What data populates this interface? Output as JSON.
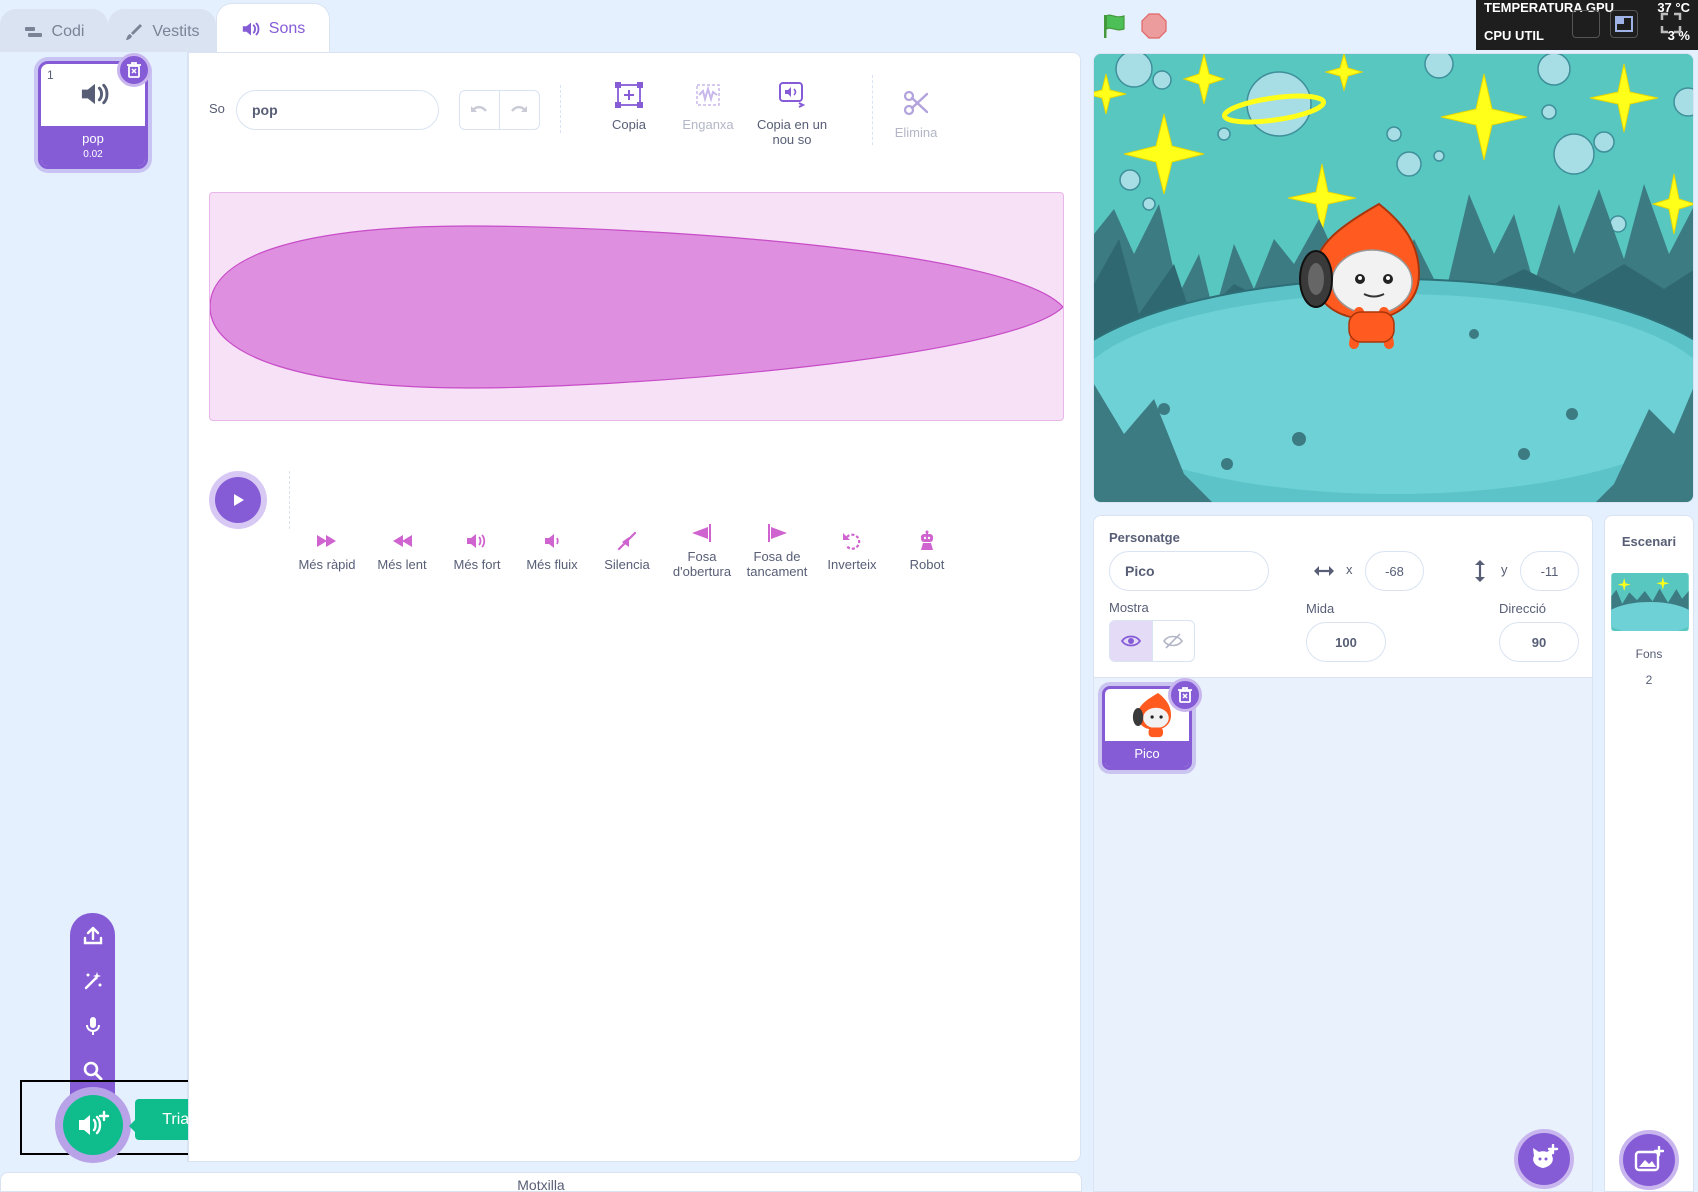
{
  "tabs": [
    {
      "label": "Codi",
      "icon": "code-icon"
    },
    {
      "label": "Vestits",
      "icon": "brush-icon"
    },
    {
      "label": "Sons",
      "icon": "speaker-icon"
    }
  ],
  "sound_list": {
    "items": [
      {
        "index": "1",
        "name": "pop",
        "duration": "0.02"
      }
    ]
  },
  "editor": {
    "name_label": "So",
    "name_value": "pop",
    "tools": {
      "copy": "Copia",
      "paste": "Enganxa",
      "copy_new": "Copia en un nou so",
      "delete": "Elimina"
    },
    "effects": [
      {
        "label": "Més ràpid"
      },
      {
        "label": "Més lent"
      },
      {
        "label": "Més fort"
      },
      {
        "label": "Més fluix"
      },
      {
        "label": "Silencia"
      },
      {
        "label": "Fosa d'obertura"
      },
      {
        "label": "Fosa de tancament"
      },
      {
        "label": "Inverteix"
      },
      {
        "label": "Robot"
      }
    ]
  },
  "add_sound_menu": {
    "tooltip": "Tria un so",
    "items": [
      "upload-icon",
      "surprise-icon",
      "record-icon",
      "search-icon"
    ]
  },
  "backpack": {
    "label": "Motxilla"
  },
  "gpu_overlay": {
    "row1_label": "TEMPERATURA GPU",
    "row1_value": "37 °C",
    "row2_label": "CPU UTIL",
    "row2_value": "3 %"
  },
  "sprite_info": {
    "sprite_label": "Personatge",
    "sprite_name": "Pico",
    "x_label": "x",
    "x_value": "-68",
    "y_label": "y",
    "y_value": "-11",
    "show_label": "Mostra",
    "size_label": "Mida",
    "size_value": "100",
    "direction_label": "Direcció",
    "direction_value": "90"
  },
  "sprites": [
    {
      "name": "Pico"
    }
  ],
  "stage_pane": {
    "title": "Escenari",
    "backdrops_label": "Fons",
    "backdrops_count": "2"
  },
  "colors": {
    "accent": "#855cd6",
    "sound_effect": "#cf63cf",
    "waveform_fill": "#df8fdf",
    "waveform_bg": "#f7e1f7",
    "tooltip": "#0fbd8c"
  }
}
